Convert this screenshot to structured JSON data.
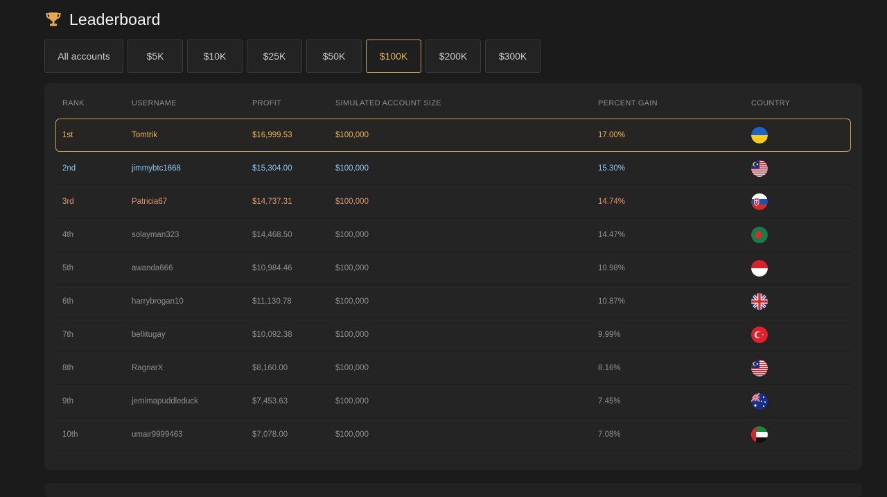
{
  "header": {
    "title": "Leaderboard",
    "icon": "trophy-icon"
  },
  "tabs": [
    {
      "label": "All accounts",
      "active": false
    },
    {
      "label": "$5K",
      "active": false
    },
    {
      "label": "$10K",
      "active": false
    },
    {
      "label": "$25K",
      "active": false
    },
    {
      "label": "$50K",
      "active": false
    },
    {
      "label": "$100K",
      "active": true
    },
    {
      "label": "$200K",
      "active": false
    },
    {
      "label": "$300K",
      "active": false
    }
  ],
  "table": {
    "columns": [
      "RANK",
      "USERNAME",
      "PROFIT",
      "SIMULATED ACCOUNT SIZE",
      "PERCENT GAIN",
      "COUNTRY"
    ],
    "rows": [
      {
        "rank": "1st",
        "username": "Tomtrik",
        "profit": "$16,999.53",
        "size": "$100,000",
        "gain": "17.00%",
        "country": "ukraine"
      },
      {
        "rank": "2nd",
        "username": "jimmybtc1668",
        "profit": "$15,304.00",
        "size": "$100,000",
        "gain": "15.30%",
        "country": "malaysia"
      },
      {
        "rank": "3rd",
        "username": "Patricia67",
        "profit": "$14,737.31",
        "size": "$100,000",
        "gain": "14.74%",
        "country": "slovakia"
      },
      {
        "rank": "4th",
        "username": "solayman323",
        "profit": "$14,468.50",
        "size": "$100,000",
        "gain": "14.47%",
        "country": "bangladesh"
      },
      {
        "rank": "5th",
        "username": "awanda666",
        "profit": "$10,984.46",
        "size": "$100,000",
        "gain": "10.98%",
        "country": "indonesia"
      },
      {
        "rank": "6th",
        "username": "harrybrogan10",
        "profit": "$11,130.78",
        "size": "$100,000",
        "gain": "10.87%",
        "country": "united-kingdom"
      },
      {
        "rank": "7th",
        "username": "bellitugay",
        "profit": "$10,092.38",
        "size": "$100,000",
        "gain": "9.99%",
        "country": "turkey"
      },
      {
        "rank": "8th",
        "username": "RagnarX",
        "profit": "$8,160.00",
        "size": "$100,000",
        "gain": "8.16%",
        "country": "malaysia"
      },
      {
        "rank": "9th",
        "username": "jemimapuddleduck",
        "profit": "$7,453.63",
        "size": "$100,000",
        "gain": "7.45%",
        "country": "australia"
      },
      {
        "rank": "10th",
        "username": "umair9999463",
        "profit": "$7,078.00",
        "size": "$100,000",
        "gain": "7.08%",
        "country": "uae"
      }
    ]
  },
  "colors": {
    "gold": "#e7b45a",
    "silver_blue": "#8cc6f2",
    "bronze": "#e3956a",
    "muted": "#8f8f8f",
    "active_border": "#c9a34e"
  }
}
